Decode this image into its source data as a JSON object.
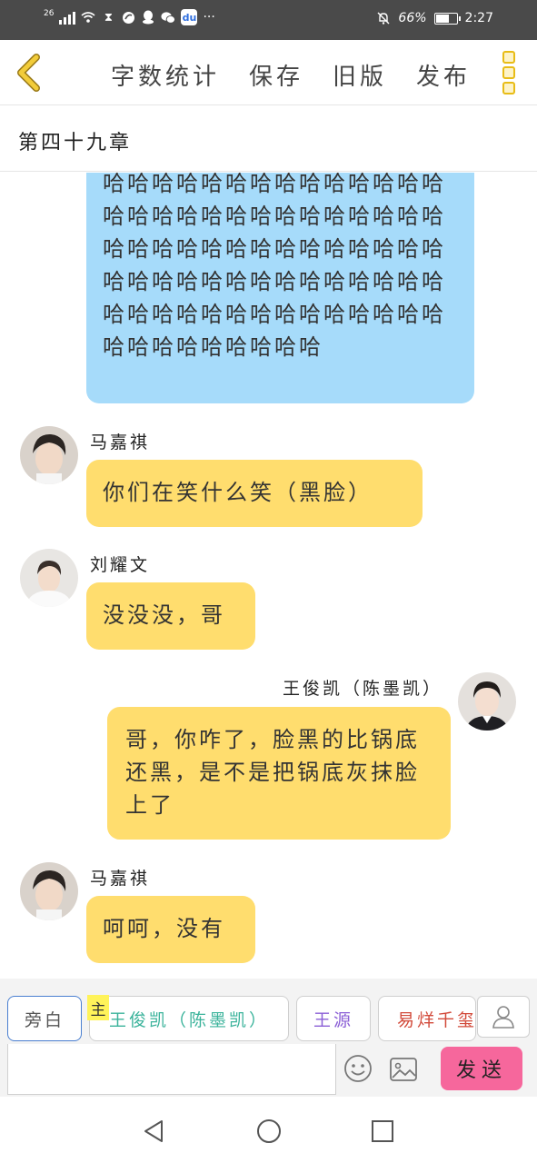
{
  "status_bar": {
    "network": "26",
    "battery": "66%",
    "battery_level": 0.66,
    "time": "2:27",
    "more": "···"
  },
  "header": {
    "toolbar": [
      "字数统计",
      "保存",
      "旧版",
      "发布"
    ]
  },
  "chapter": {
    "title": "第四十九章"
  },
  "messages": [
    {
      "text": "哈哈哈哈哈哈哈哈哈哈哈哈哈哈哈哈哈哈哈哈哈哈哈哈哈哈哈哈哈哈哈哈哈哈哈哈哈哈哈哈哈哈哈哈哈哈哈哈哈哈哈哈哈哈哈哈哈哈哈哈哈哈哈哈哈哈哈哈哈哈哈哈哈哈哈哈哈哈哈",
      "color": "#a6dbfa"
    },
    {
      "speaker": "马嘉祺",
      "text": "你们在笑什么笑（黑脸）"
    },
    {
      "speaker": "刘耀文",
      "text": "没没没，哥"
    },
    {
      "speaker": "王俊凯（陈墨凯）",
      "text": "哥，你咋了，脸黑的比锅底还黑，是不是把锅底灰抹脸上了"
    },
    {
      "speaker": "马嘉祺",
      "text": "呵呵，没有"
    }
  ],
  "bottom": {
    "roles": [
      {
        "label": "旁白",
        "color": "#555555"
      },
      {
        "label": "王俊凯（陈墨凯）",
        "color": "#3bb39b"
      },
      {
        "label": "王源",
        "color": "#8b5fd6"
      },
      {
        "label": "易烊千玺",
        "color": "#d24a3a"
      }
    ],
    "main_badge": "主",
    "send": "发送"
  }
}
